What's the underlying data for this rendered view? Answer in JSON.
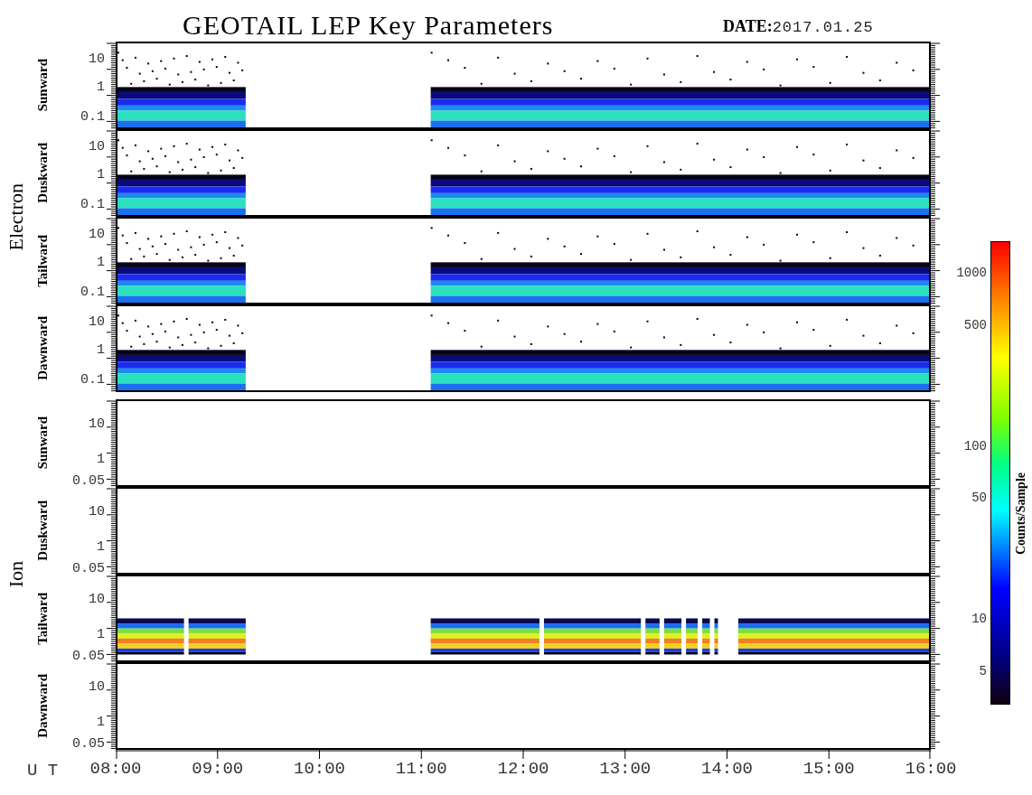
{
  "title": "GEOTAIL LEP Key Parameters",
  "date_label": "DATE:",
  "date": "2017.01.25",
  "groups": [
    {
      "name": "Electron",
      "panels": [
        {
          "name": "Sunward",
          "kind": "electron-spectrum",
          "yticks": [
            "10",
            "1",
            "0.1"
          ]
        },
        {
          "name": "Duskward",
          "kind": "electron-spectrum",
          "yticks": [
            "10",
            "1",
            "0.1"
          ]
        },
        {
          "name": "Tailward",
          "kind": "electron-spectrum",
          "yticks": [
            "10",
            "1",
            "0.1"
          ]
        },
        {
          "name": "Dawnward",
          "kind": "electron-spectrum",
          "yticks": [
            "10",
            "1",
            "0.1"
          ]
        }
      ]
    },
    {
      "name": "Ion",
      "panels": [
        {
          "name": "Sunward",
          "kind": "empty",
          "yticks": [
            "10",
            "1",
            "0.05"
          ]
        },
        {
          "name": "Duskward",
          "kind": "empty",
          "yticks": [
            "10",
            "1",
            "0.05"
          ]
        },
        {
          "name": "Tailward",
          "kind": "ion-spectrum",
          "yticks": [
            "10",
            "1",
            "0.05"
          ]
        },
        {
          "name": "Dawnward",
          "kind": "empty",
          "yticks": [
            "10",
            "1",
            "0.05"
          ]
        }
      ]
    }
  ],
  "x_axis": {
    "label": "U T",
    "ticks": [
      "08:00",
      "09:00",
      "10:00",
      "11:00",
      "12:00",
      "13:00",
      "14:00",
      "15:00",
      "16:00"
    ]
  },
  "colorbar": {
    "title": "Counts/Sample",
    "ticks": [
      "1000",
      "500",
      "100",
      "50",
      "10",
      "5"
    ]
  }
}
